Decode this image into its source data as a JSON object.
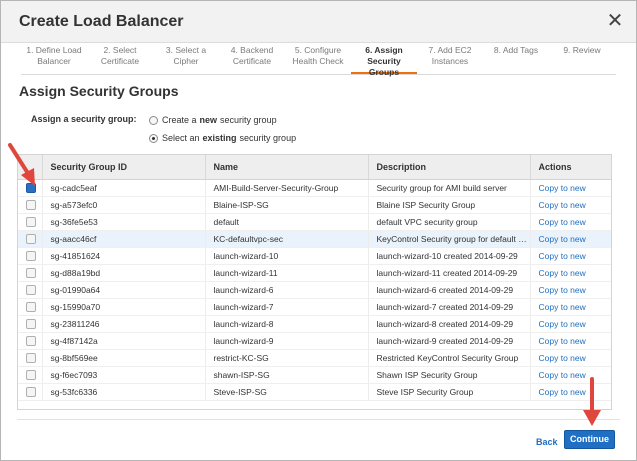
{
  "dialog": {
    "title": "Create Load Balancer",
    "close_glyph": "✕"
  },
  "steps": [
    {
      "label": "1. Define Load Balancer",
      "active": false
    },
    {
      "label": "2. Select Certificate",
      "active": false
    },
    {
      "label": "3. Select a Cipher",
      "active": false
    },
    {
      "label": "4. Backend Certificate",
      "active": false
    },
    {
      "label": "5. Configure Health Check",
      "active": false
    },
    {
      "label": "6. Assign Security Groups",
      "active": true
    },
    {
      "label": "7. Add EC2 Instances",
      "active": false
    },
    {
      "label": "8. Add Tags",
      "active": false
    },
    {
      "label": "9. Review",
      "active": false
    }
  ],
  "section": {
    "title": "Assign Security Groups",
    "assign_label": "Assign a security group:",
    "option_new_pre": "Create a",
    "option_new_bold": "new",
    "option_new_post": "security group",
    "option_existing_pre": "Select an",
    "option_existing_bold": "existing",
    "option_existing_post": "security group",
    "selected_option": "existing"
  },
  "table": {
    "columns": [
      "Security Group ID",
      "Name",
      "Description",
      "Actions"
    ],
    "rows": [
      {
        "id": "sg-cadc5eaf",
        "name": "AMI-Build-Server-Security-Group",
        "description": "Security group for AMI build server",
        "action": "Copy to new",
        "checked": true,
        "highlight": false
      },
      {
        "id": "sg-a573efc0",
        "name": "Blaine-ISP-SG",
        "description": "Blaine ISP Security Group",
        "action": "Copy to new",
        "checked": false,
        "highlight": false
      },
      {
        "id": "sg-36fe5e53",
        "name": "default",
        "description": "default VPC security group",
        "action": "Copy to new",
        "checked": false,
        "highlight": false
      },
      {
        "id": "sg-aacc46cf",
        "name": "KC-defaultvpc-sec",
        "description": "KeyControl Security group for default vpc",
        "action": "Copy to new",
        "checked": false,
        "highlight": true
      },
      {
        "id": "sg-41851624",
        "name": "launch-wizard-10",
        "description": "launch-wizard-10 created 2014-09-29",
        "action": "Copy to new",
        "checked": false,
        "highlight": false
      },
      {
        "id": "sg-d88a19bd",
        "name": "launch-wizard-11",
        "description": "launch-wizard-11 created 2014-09-29",
        "action": "Copy to new",
        "checked": false,
        "highlight": false
      },
      {
        "id": "sg-01990a64",
        "name": "launch-wizard-6",
        "description": "launch-wizard-6 created 2014-09-29",
        "action": "Copy to new",
        "checked": false,
        "highlight": false
      },
      {
        "id": "sg-15990a70",
        "name": "launch-wizard-7",
        "description": "launch-wizard-7 created 2014-09-29",
        "action": "Copy to new",
        "checked": false,
        "highlight": false
      },
      {
        "id": "sg-23811246",
        "name": "launch-wizard-8",
        "description": "launch-wizard-8 created 2014-09-29",
        "action": "Copy to new",
        "checked": false,
        "highlight": false
      },
      {
        "id": "sg-4f87142a",
        "name": "launch-wizard-9",
        "description": "launch-wizard-9 created 2014-09-29",
        "action": "Copy to new",
        "checked": false,
        "highlight": false
      },
      {
        "id": "sg-8bf569ee",
        "name": "restrict-KC-SG",
        "description": "Restricted KeyControl Security Group",
        "action": "Copy to new",
        "checked": false,
        "highlight": false
      },
      {
        "id": "sg-f6ec7093",
        "name": "shawn-ISP-SG",
        "description": "Shawn ISP Security Group",
        "action": "Copy to new",
        "checked": false,
        "highlight": false
      },
      {
        "id": "sg-53fc6336",
        "name": "Steve-ISP-SG",
        "description": "Steve ISP Security Group",
        "action": "Copy to new",
        "checked": false,
        "highlight": false
      }
    ]
  },
  "footer": {
    "back_label": "Back",
    "continue_label": "Continue"
  },
  "colors": {
    "accent_blue": "#1f6fc4",
    "annotation_red": "#e0473c",
    "active_step_underline": "#ec7211"
  },
  "annotations": {
    "icon": "red-arrow-icon"
  }
}
